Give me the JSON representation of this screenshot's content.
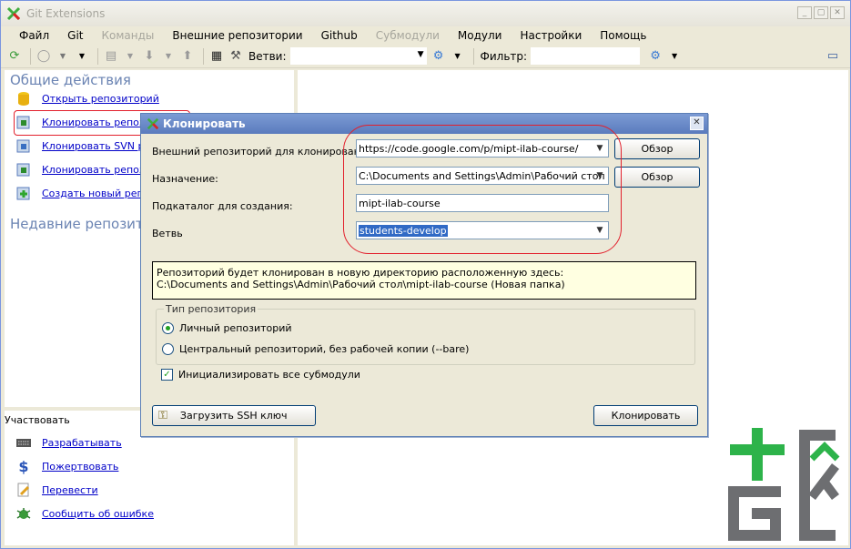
{
  "window": {
    "title": "Git Extensions"
  },
  "menu": [
    "Файл",
    "Git",
    "Команды",
    "Внешние репозитории",
    "Github",
    "Субмодули",
    "Модули",
    "Настройки",
    "Помощь"
  ],
  "toolbar": {
    "branches_label": "Ветви:",
    "branches_value": "",
    "filter_label": "Фильтр:",
    "filter_value": ""
  },
  "left": {
    "common_title": "Общие действия",
    "actions": [
      "Открыть репозиторий",
      "Клонировать репози",
      "Клонировать SVN реп",
      "Клонировать репози",
      "Создать новый репоз"
    ],
    "recent_title": "Недавние репозито",
    "contribute_title": "Участвовать",
    "contribute": [
      "Разрабатывать",
      "Пожертвовать",
      "Перевести",
      "Сообщить об ошибке"
    ]
  },
  "dialog": {
    "title": "Клонировать",
    "remote_label": "Внешний репозиторий для клонирования",
    "remote_value": "https://code.google.com/p/mipt-ilab-course/",
    "dest_label": "Назначение:",
    "dest_value": "C:\\Documents and Settings\\Admin\\Рабочий стол",
    "subdir_label": "Подкаталог для создания:",
    "subdir_value": "mipt-ilab-course",
    "branch_label": "Ветвь",
    "branch_value": "students-develop",
    "browse_label": "Обзор",
    "info_line1": "Репозиторий будет клонирован в новую директорию расположенную здесь:",
    "info_line2": "C:\\Documents and Settings\\Admin\\Рабочий стол\\mipt-ilab-course (Новая папка)",
    "repo_type_title": "Тип репозитория",
    "repo_type_personal": "Личный репозиторий",
    "repo_type_central": "Центральный репозиторий, без рабочей копии (--bare)",
    "init_submodules": "Инициализировать все субмодули",
    "load_ssh": "Загрузить SSH ключ",
    "clone_button": "Клонировать"
  },
  "colors": {
    "link": "#0000c8",
    "section_title": "#6b84b3",
    "dialog_title_bar": "#5a7bbd",
    "info_bg": "#ffffe1",
    "annotation_red": "#e2202c",
    "logo_green": "#2db34a",
    "logo_gray": "#6d6e71"
  }
}
